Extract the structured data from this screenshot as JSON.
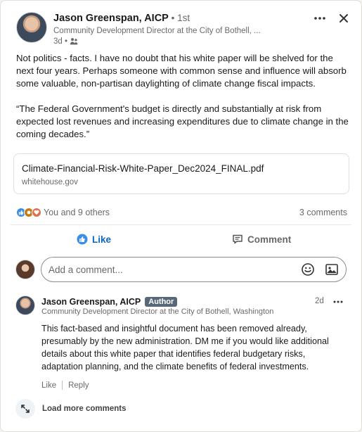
{
  "post": {
    "author_name": "Jason Greenspan, AICP",
    "connection": "• 1st",
    "author_title": "Community Development Director at the City of Bothell, ...",
    "time": "3d •",
    "text_p1": "Not politics - facts. I have no doubt that his white paper will be shelved for the next four years. Perhaps someone with common sense and influence will absorb some valuable, non-partisan daylighting of climate change fiscal impacts.",
    "text_p2": "“The Federal Government's budget is directly and substantially at risk from expected lost revenues and increasing expenditures due to climate change in the coming decades.”",
    "document": {
      "title": "Climate-Financial-Risk-White-Paper_Dec2024_FINAL.pdf",
      "source": "whitehouse.gov"
    },
    "reactions_text": "You and 9 others",
    "comments_count": "3 comments",
    "icons": [
      "more-icon",
      "close-icon",
      "globe-icon"
    ]
  },
  "actions": {
    "like_label": "Like",
    "comment_label": "Comment"
  },
  "comment_box": {
    "placeholder": "Add a comment..."
  },
  "comment": {
    "author_name": "Jason Greenspan, AICP",
    "badge": "Author",
    "author_title": "Community Development Director at the City of Bothell, Washington",
    "time": "2d",
    "text": "This fact-based and insightful document has been removed already, presumably by the new administration. DM me if you would like additional details about this white paper that identifies federal budgetary risks, adaptation planning, and the climate benefits of federal investments.",
    "like_label": "Like",
    "reply_label": "Reply"
  },
  "load_more_label": "Load more comments",
  "colors": {
    "accent": "#0a66c2",
    "badge_bg": "#56687a"
  }
}
